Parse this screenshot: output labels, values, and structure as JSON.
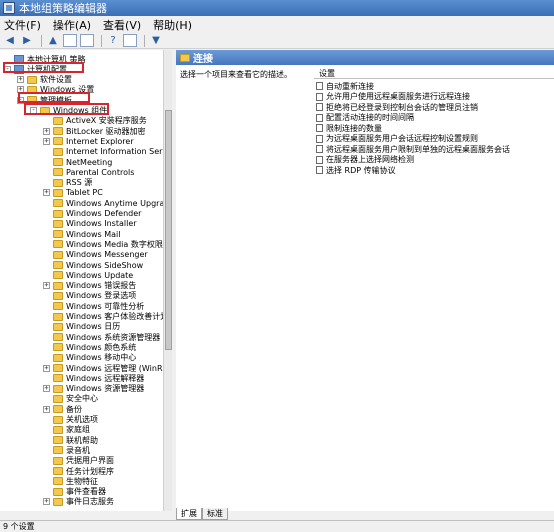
{
  "window": {
    "title": "本地组策略编辑器"
  },
  "menu": [
    "文件(F)",
    "操作(A)",
    "查看(V)",
    "帮助(H)"
  ],
  "toolbar": [
    "back-arrow-icon",
    "forward-arrow-icon",
    "up-folder-icon",
    "show-hide-tree-icon",
    "export-list-icon",
    "help-icon",
    "properties-icon",
    "filter-icon"
  ],
  "tree": [
    {
      "label": "本地计算机 策略",
      "level": 0,
      "icon": "computer",
      "exp": ""
    },
    {
      "label": "计算机配置",
      "level": 0,
      "icon": "computer",
      "exp": "-"
    },
    {
      "label": "软件设置",
      "level": 1,
      "icon": "folder",
      "exp": "+"
    },
    {
      "label": "Windows 设置",
      "level": 1,
      "icon": "folder",
      "exp": "+"
    },
    {
      "label": "管理模板",
      "level": 1,
      "icon": "folder",
      "exp": "-"
    },
    {
      "label": "Windows 组件",
      "level": 2,
      "icon": "folder",
      "exp": "-"
    },
    {
      "label": "ActiveX 安装程序服务",
      "level": 3,
      "icon": "folder",
      "exp": ""
    },
    {
      "label": "BitLocker 驱动器加密",
      "level": 3,
      "icon": "folder",
      "exp": "+"
    },
    {
      "label": "Internet Explorer",
      "level": 3,
      "icon": "folder",
      "exp": "+"
    },
    {
      "label": "Internet Information Serv",
      "level": 3,
      "icon": "folder",
      "exp": ""
    },
    {
      "label": "NetMeeting",
      "level": 3,
      "icon": "folder",
      "exp": ""
    },
    {
      "label": "Parental Controls",
      "level": 3,
      "icon": "folder",
      "exp": ""
    },
    {
      "label": "RSS 源",
      "level": 3,
      "icon": "folder",
      "exp": ""
    },
    {
      "label": "Tablet PC",
      "level": 3,
      "icon": "folder",
      "exp": "+"
    },
    {
      "label": "Windows Anytime Upgrade",
      "level": 3,
      "icon": "folder",
      "exp": ""
    },
    {
      "label": "Windows Defender",
      "level": 3,
      "icon": "folder",
      "exp": ""
    },
    {
      "label": "Windows Installer",
      "level": 3,
      "icon": "folder",
      "exp": ""
    },
    {
      "label": "Windows Mail",
      "level": 3,
      "icon": "folder",
      "exp": ""
    },
    {
      "label": "Windows Media 数字权限管理",
      "level": 3,
      "icon": "folder",
      "exp": ""
    },
    {
      "label": "Windows Messenger",
      "level": 3,
      "icon": "folder",
      "exp": ""
    },
    {
      "label": "Windows SideShow",
      "level": 3,
      "icon": "folder",
      "exp": ""
    },
    {
      "label": "Windows Update",
      "level": 3,
      "icon": "folder",
      "exp": ""
    },
    {
      "label": "Windows 错误报告",
      "level": 3,
      "icon": "folder",
      "exp": "+"
    },
    {
      "label": "Windows 登录选项",
      "level": 3,
      "icon": "folder",
      "exp": ""
    },
    {
      "label": "Windows 可靠性分析",
      "level": 3,
      "icon": "folder",
      "exp": ""
    },
    {
      "label": "Windows 客户体验改善计划",
      "level": 3,
      "icon": "folder",
      "exp": ""
    },
    {
      "label": "Windows 日历",
      "level": 3,
      "icon": "folder",
      "exp": ""
    },
    {
      "label": "Windows 系统资源管理器",
      "level": 3,
      "icon": "folder",
      "exp": ""
    },
    {
      "label": "Windows 颜色系统",
      "level": 3,
      "icon": "folder",
      "exp": ""
    },
    {
      "label": "Windows 移动中心",
      "level": 3,
      "icon": "folder",
      "exp": ""
    },
    {
      "label": "Windows 远程管理 (WinRM)",
      "level": 3,
      "icon": "folder",
      "exp": "+"
    },
    {
      "label": "Windows 远程解释器",
      "level": 3,
      "icon": "folder",
      "exp": ""
    },
    {
      "label": "Windows 资源管理器",
      "level": 3,
      "icon": "folder",
      "exp": "+"
    },
    {
      "label": "安全中心",
      "level": 3,
      "icon": "folder",
      "exp": ""
    },
    {
      "label": "备份",
      "level": 3,
      "icon": "folder",
      "exp": "+"
    },
    {
      "label": "关机选项",
      "level": 3,
      "icon": "folder",
      "exp": ""
    },
    {
      "label": "家庭组",
      "level": 3,
      "icon": "folder",
      "exp": ""
    },
    {
      "label": "联机帮助",
      "level": 3,
      "icon": "folder",
      "exp": ""
    },
    {
      "label": "录音机",
      "level": 3,
      "icon": "folder",
      "exp": ""
    },
    {
      "label": "凭据用户界面",
      "level": 3,
      "icon": "folder",
      "exp": ""
    },
    {
      "label": "任务计划程序",
      "level": 3,
      "icon": "folder",
      "exp": ""
    },
    {
      "label": "生物特征",
      "level": 3,
      "icon": "folder",
      "exp": ""
    },
    {
      "label": "事件查看器",
      "level": 3,
      "icon": "folder",
      "exp": ""
    },
    {
      "label": "事件日志服务",
      "level": 3,
      "icon": "folder",
      "exp": "+"
    }
  ],
  "right_panel": {
    "header": "连接",
    "description": "选择一个项目来查看它的描述。",
    "column_header": "设置",
    "policies": [
      "自动重新连接",
      "允许用户使用远程桌面服务进行远程连接",
      "拒绝将已经登录到控制台会话的管理员注销",
      "配置活动连接的时间间隔",
      "限制连接的数量",
      "为远程桌面服务用户会话远程控制设置规则",
      "将远程桌面服务用户限制到单独的远程桌面服务会话",
      "在服务器上选择网络检测",
      "选择 RDP 传输协议"
    ]
  },
  "tabs": [
    "扩展",
    "标准"
  ],
  "status": {
    "text": "9 个设置"
  }
}
